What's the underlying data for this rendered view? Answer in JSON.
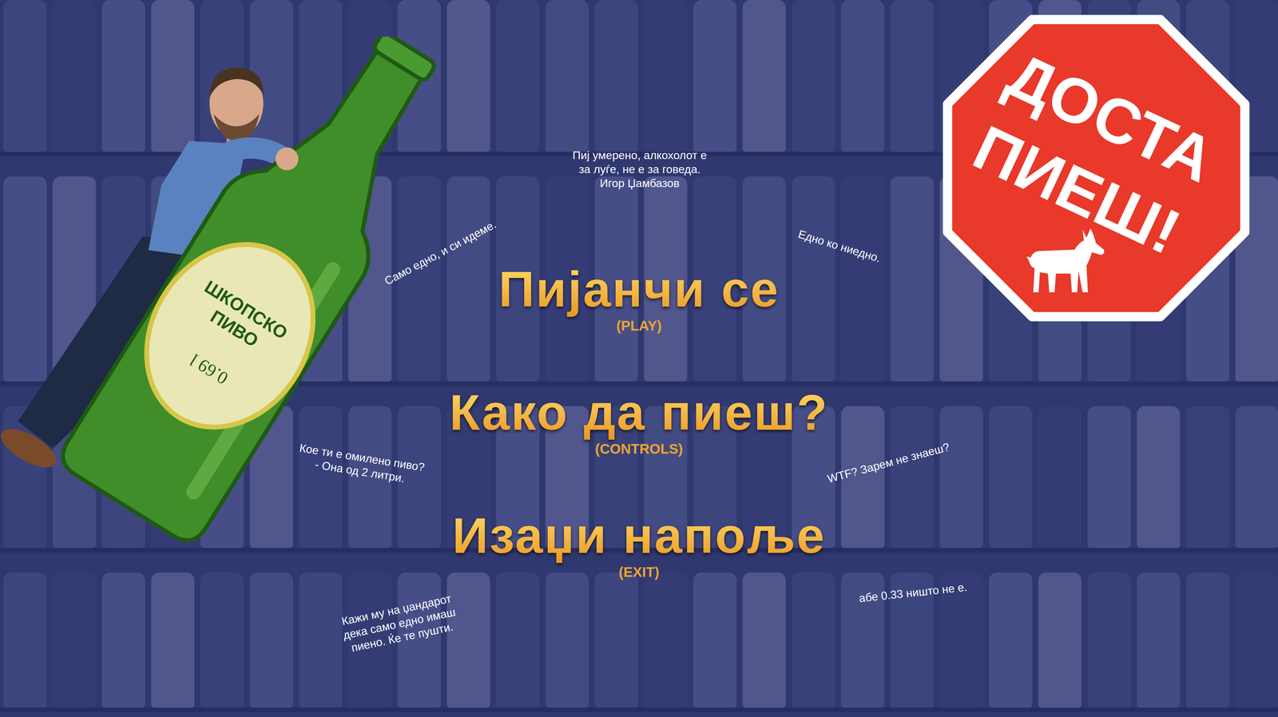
{
  "menu": [
    {
      "label": "Пијанчи се",
      "hint": "(PLAY)"
    },
    {
      "label": "Како да пиеш?",
      "hint": "(CONTROLS)"
    },
    {
      "label": "Изаџи напоље",
      "hint": "(EXIT)"
    }
  ],
  "quotes": [
    {
      "lines": [
        "Пиј умерено, алкохолот е",
        "за луѓе, не е за говеда.",
        "Игор Џамбазов"
      ]
    },
    {
      "lines": [
        "Само едно, и си идеме."
      ]
    },
    {
      "lines": [
        "Едно ко ниедно."
      ]
    },
    {
      "lines": [
        "Кое ти е омилено пиво?",
        "- Она од 2 литри."
      ]
    },
    {
      "lines": [
        "WTF? Зарем не знаеш?"
      ]
    },
    {
      "lines": [
        "Кажи му на џандарот",
        "дека само едно имаш",
        "пиено. Ќе те пушти."
      ]
    },
    {
      "lines": [
        "абе 0.33 ништо не е."
      ]
    }
  ],
  "stop_sign": {
    "lines": [
      "ДОСТА",
      "ПИЕШ!"
    ]
  },
  "bottle": {
    "brand": [
      "ШКОПСКО",
      "ПИВО"
    ],
    "volume": "0.69 l"
  }
}
